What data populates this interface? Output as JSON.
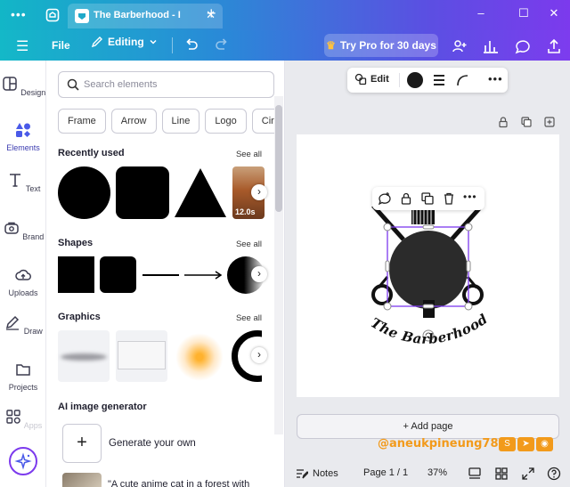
{
  "browser": {
    "tab_title": "The Barberhood - I",
    "tab_close": "✕",
    "new_tab": "+",
    "menu_dots": "•••",
    "window_controls": {
      "minimize": "–",
      "maximize": "☐",
      "close": "✕"
    }
  },
  "appbar": {
    "file": "File",
    "editing": "Editing",
    "try_pro": "Try Pro for 30 days",
    "colors": {
      "gradient_start": "#12b6c7",
      "gradient_end": "#7c3aed",
      "pro_crown": "#ffc23d"
    }
  },
  "rail": {
    "items": [
      {
        "label": "Design",
        "icon": "layout-icon"
      },
      {
        "label": "Elements",
        "icon": "shapes-icon"
      },
      {
        "label": "Text",
        "icon": "text-icon"
      },
      {
        "label": "Brand",
        "icon": "brand-icon"
      },
      {
        "label": "Uploads",
        "icon": "cloud-upload-icon"
      },
      {
        "label": "Draw",
        "icon": "pen-icon"
      },
      {
        "label": "Projects",
        "icon": "folder-icon"
      },
      {
        "label": "Apps",
        "icon": "apps-icon"
      }
    ],
    "active": "Elements"
  },
  "panel": {
    "search_placeholder": "Search elements",
    "chips": [
      "Frame",
      "Arrow",
      "Line",
      "Logo",
      "Cir"
    ],
    "sections": {
      "recently_used": "Recently used",
      "shapes": "Shapes",
      "graphics": "Graphics",
      "ai_generator": "AI image generator"
    },
    "see_all": "See all",
    "video_duration": "12.0s",
    "generate_label": "Generate your own",
    "prompt_example": "\"A cute anime cat in a forest with"
  },
  "canvas": {
    "edit_label": "Edit",
    "logo_text": "The Barberhood",
    "add_page": "+ Add page",
    "watermark": "@aneukpineung78",
    "watermark_icons": [
      "S",
      "➤",
      "◉"
    ]
  },
  "bottombar": {
    "notes": "Notes",
    "page": "Page 1 / 1",
    "zoom": "37%"
  }
}
